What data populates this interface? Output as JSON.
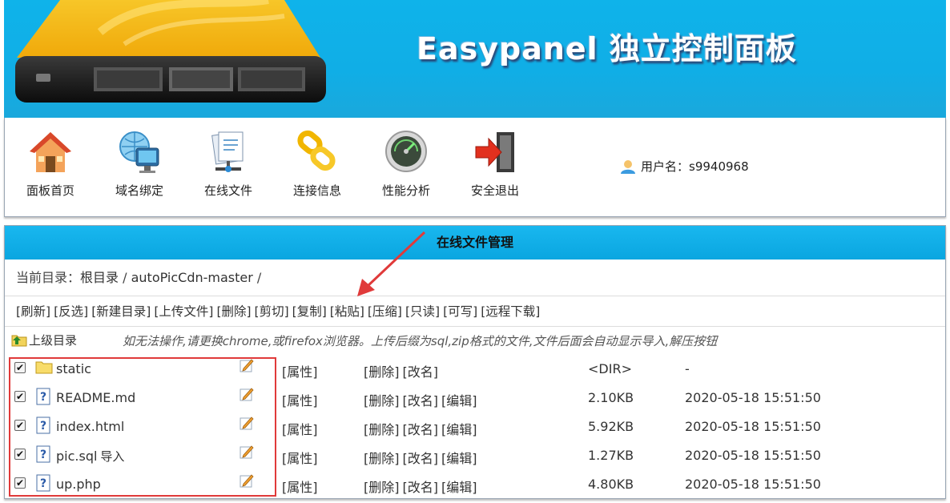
{
  "banner": {
    "title": "Easypanel 独立控制面板"
  },
  "nav": {
    "items": [
      {
        "label": "面板首页",
        "icon": "house-icon"
      },
      {
        "label": "域名绑定",
        "icon": "globe-monitor-icon"
      },
      {
        "label": "在线文件",
        "icon": "files-network-icon"
      },
      {
        "label": "连接信息",
        "icon": "link-chain-icon"
      },
      {
        "label": "性能分析",
        "icon": "gauge-icon"
      },
      {
        "label": "安全退出",
        "icon": "logout-door-icon"
      }
    ],
    "user_label": "用户名：s9940968"
  },
  "file_manager": {
    "title": "在线文件管理",
    "breadcrumb": {
      "prefix": "当前目录：",
      "root": "根目录",
      "sep1": " / ",
      "folder": "autoPicCdn-master",
      "sep2": " /"
    },
    "toolbar": [
      "[刷新]",
      "[反选]",
      "[新建目录]",
      "[上传文件]",
      "[删除]",
      "[剪切]",
      "[复制]",
      "[粘贴]",
      "[压缩]",
      "[只读]",
      "[可写]",
      "[远程下载]"
    ],
    "parent_dir": "上级目录",
    "hint": "如无法操作,请更换chrome,或firefox浏览器。上传后缀为sql,zip格式的文件,文件后面会自动显示导入,解压按钮",
    "files": [
      {
        "name": "static",
        "type": "folder",
        "extra": "",
        "prop": "[属性]",
        "actions": [
          "[删除]",
          "[改名]"
        ],
        "size": "<DIR>",
        "date": "-",
        "checked": true
      },
      {
        "name": "README.md",
        "type": "file",
        "extra": "",
        "prop": "[属性]",
        "actions": [
          "[删除]",
          "[改名]",
          "[编辑]"
        ],
        "size": "2.10KB",
        "date": "2020-05-18 15:51:50",
        "checked": true
      },
      {
        "name": "index.html",
        "type": "file",
        "extra": "",
        "prop": "[属性]",
        "actions": [
          "[删除]",
          "[改名]",
          "[编辑]"
        ],
        "size": "5.92KB",
        "date": "2020-05-18 15:51:50",
        "checked": true
      },
      {
        "name": "pic.sql",
        "type": "file",
        "extra": "导入",
        "prop": "[属性]",
        "actions": [
          "[删除]",
          "[改名]",
          "[编辑]"
        ],
        "size": "1.27KB",
        "date": "2020-05-18 15:51:50",
        "checked": true
      },
      {
        "name": "up.php",
        "type": "file",
        "extra": "",
        "prop": "[属性]",
        "actions": [
          "[删除]",
          "[改名]",
          "[编辑]"
        ],
        "size": "4.80KB",
        "date": "2020-05-18 15:51:50",
        "checked": true
      }
    ]
  },
  "annotation": {
    "highlight_color": "#e03a3a"
  }
}
